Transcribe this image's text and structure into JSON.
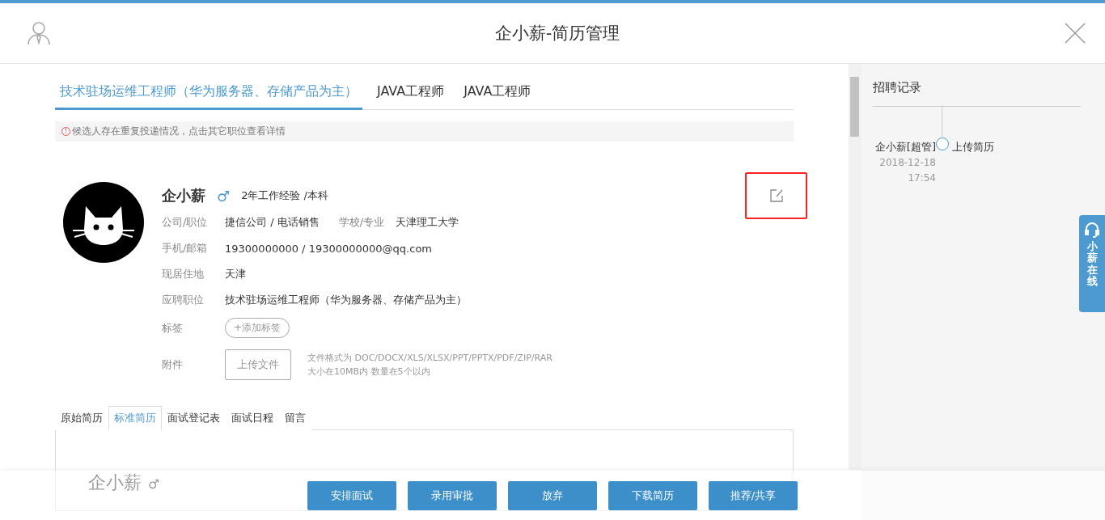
{
  "header": {
    "title": "企小薪-简历管理"
  },
  "job_tabs": [
    {
      "label": "技术驻场运维工程师（华为服务器、存储产品为主）",
      "selected": true
    },
    {
      "label": "JAVA工程师",
      "selected": false
    },
    {
      "label": "JAVA工程师",
      "selected": false
    }
  ],
  "notice": {
    "icon": "!",
    "text": "候选人存在重复投递情况，点击其它职位查看详情"
  },
  "candidate": {
    "name": "企小薪",
    "gender": "♂",
    "summary": "2年工作经验 /本科",
    "fields": [
      {
        "kind": "pair",
        "label": "公司/职位",
        "value": "捷信公司 / 电话销售",
        "label2": "学校/专业",
        "value2": "天津理工大学"
      },
      {
        "kind": "text",
        "label": "手机/邮箱",
        "value": "19300000000 / 19300000000@qq.com"
      },
      {
        "kind": "text",
        "label": "现居住地",
        "value": "天津"
      },
      {
        "kind": "text",
        "label": "应聘职位",
        "value": "技术驻场运维工程师（华为服务器、存储产品为主）"
      },
      {
        "kind": "tag",
        "label": "标签",
        "button": "+添加标签"
      },
      {
        "kind": "upload",
        "label": "附件",
        "button": "上传文件",
        "hint_lines": [
          "文件格式为 DOC/DOCX/XLS/XLSX/PPT/PPTX/PDF/ZIP/RAR",
          "大小在10MB内 数量在5个以内"
        ]
      }
    ]
  },
  "resume_tabs": [
    {
      "label": "原始简历",
      "selected": false
    },
    {
      "label": "标准简历",
      "selected": true
    },
    {
      "label": "面试登记表",
      "selected": false
    },
    {
      "label": "面试日程",
      "selected": false
    },
    {
      "label": "留言",
      "selected": false
    }
  ],
  "resume_preview": {
    "name": "企小薪",
    "gender": "♂"
  },
  "record_panel": {
    "title": "招聘记录",
    "entries": [
      {
        "actor": "企小薪[超管]",
        "date": "2018-12-18",
        "time": "17:54",
        "action": "上传简历"
      }
    ]
  },
  "chat_tab": {
    "label": "小薪在线"
  },
  "actions": [
    "安排面试",
    "录用审批",
    "放弃",
    "下载简历",
    "推荐/共享"
  ]
}
